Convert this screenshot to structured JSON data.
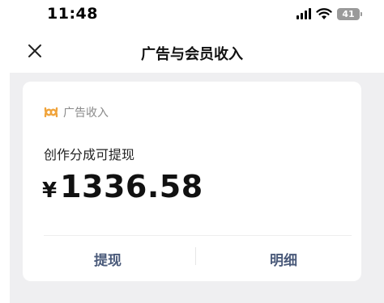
{
  "status_bar": {
    "time": "11:48",
    "battery_level": "41"
  },
  "nav": {
    "title": "广告与会员收入",
    "close_icon": "close-icon"
  },
  "card": {
    "header_label": "广告收入",
    "sub_label": "创作分成可提现",
    "currency": "¥",
    "amount": "1336.58",
    "withdraw_label": "提现",
    "details_label": "明细"
  },
  "colors": {
    "brand_orange": "#f0a43c",
    "action_text": "#4a5a7a",
    "page_background": "#efeff1"
  }
}
